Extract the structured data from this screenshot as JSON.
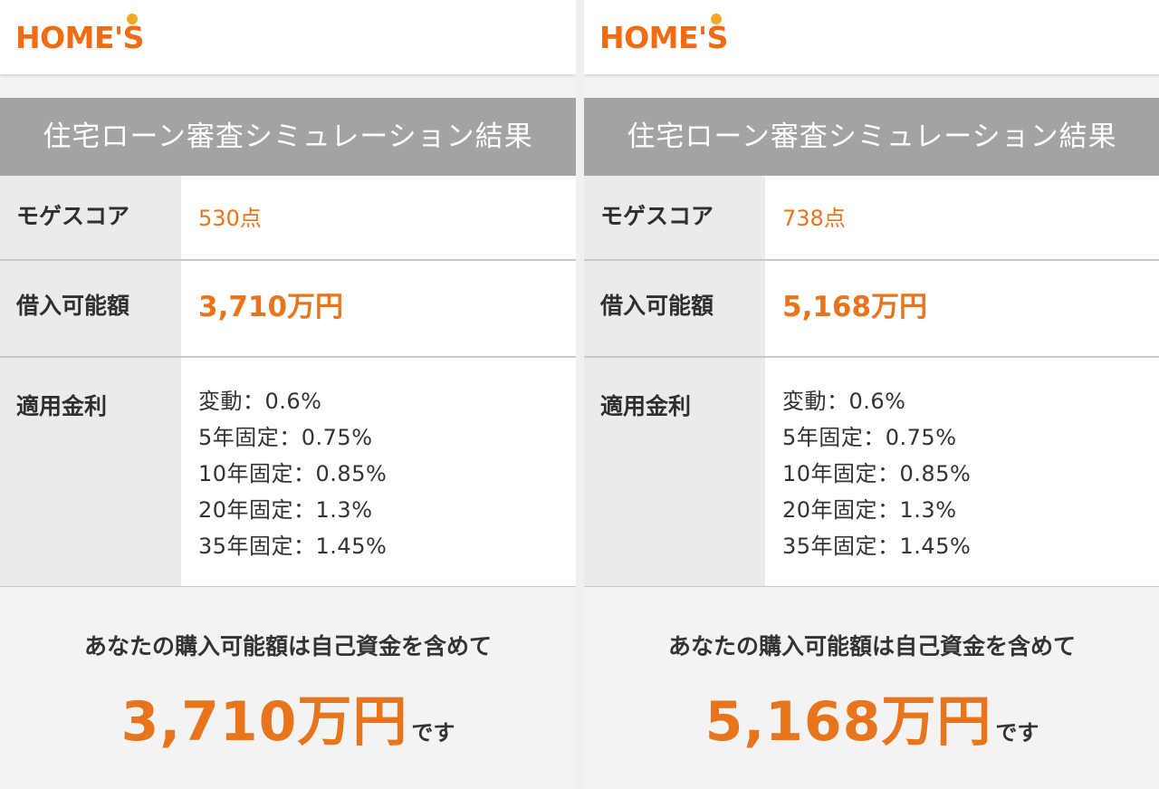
{
  "panels": [
    {
      "logo": "HOME'S",
      "title": "住宅ローン審査シミュレーション結果",
      "score_label": "モゲスコア",
      "score_value": "530点",
      "amount_label": "借入可能額",
      "amount_value": "3,710万円",
      "rates_label": "適用金利",
      "rates": [
        "変動：0.6%",
        "5年固定：0.75%",
        "10年固定：0.85%",
        "20年固定：1.3%",
        "35年固定：1.45%"
      ],
      "summary_lead": "あなたの購入可能額は自己資金を含めて",
      "summary_amount": "3,710万円",
      "summary_suffix": "です"
    },
    {
      "logo": "HOME'S",
      "title": "住宅ローン審査シミュレーション結果",
      "score_label": "モゲスコア",
      "score_value": "738点",
      "amount_label": "借入可能額",
      "amount_value": "5,168万円",
      "rates_label": "適用金利",
      "rates": [
        "変動：0.6%",
        "5年固定：0.75%",
        "10年固定：0.85%",
        "20年固定：1.3%",
        "35年固定：1.45%"
      ],
      "summary_lead": "あなたの購入可能額は自己資金を含めて",
      "summary_amount": "5,168万円",
      "summary_suffix": "です"
    }
  ],
  "colors": {
    "accent": "#e8741c",
    "title_bar": "#a3a3a3",
    "label_bg": "#ebebeb"
  }
}
